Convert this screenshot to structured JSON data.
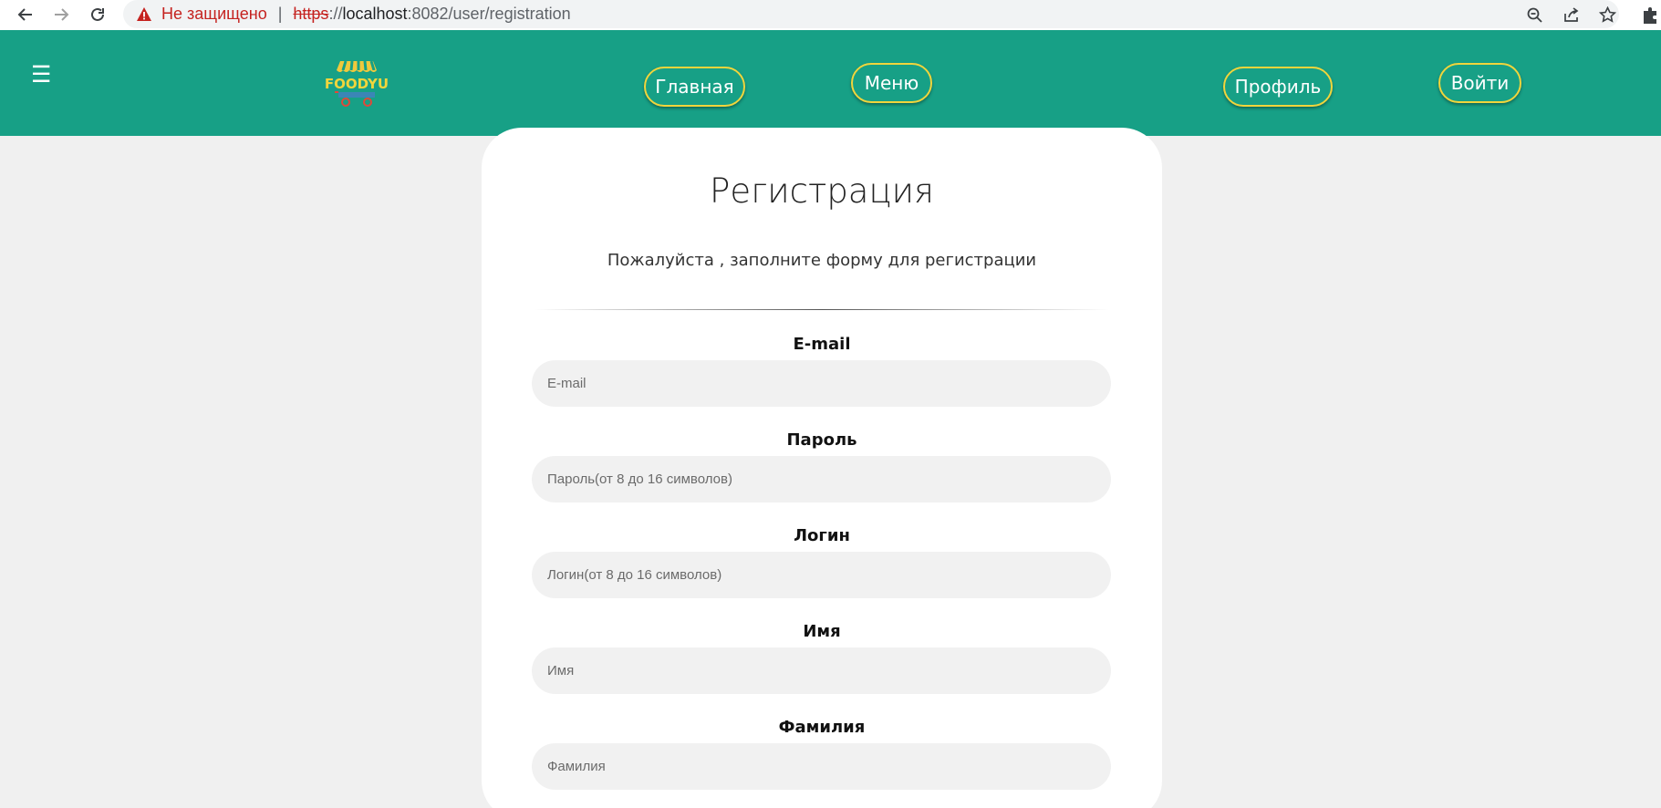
{
  "browser": {
    "security_label": "Не защищено",
    "url_scheme": "https",
    "url_sep": "://",
    "url_host": "localhost",
    "url_rest": ":8082/user/registration",
    "icons": [
      "back-icon",
      "forward-icon",
      "reload-icon",
      "warning-icon",
      "zoom-out-icon",
      "share-icon",
      "star-icon",
      "extensions-icon"
    ]
  },
  "header": {
    "menu_icon": "☰",
    "logo_text": "FOODYU",
    "nav": {
      "home": "Главная",
      "menu": "Меню",
      "profile": "Профиль",
      "login": "Войти"
    },
    "colors": {
      "background": "#17a086",
      "pill_border": "#f0d53c"
    }
  },
  "form": {
    "title": "Регистрация",
    "subtitle": "Пожалуйста , заполните форму для регистрации",
    "fields": [
      {
        "label": "E-mail",
        "placeholder": "E-mail"
      },
      {
        "label": "Пароль",
        "placeholder": "Пароль(от 8 до 16 символов)"
      },
      {
        "label": "Логин",
        "placeholder": "Логин(от 8 до 16 символов)"
      },
      {
        "label": "Имя",
        "placeholder": "Имя"
      },
      {
        "label": "Фамилия",
        "placeholder": "Фамилия"
      }
    ]
  }
}
